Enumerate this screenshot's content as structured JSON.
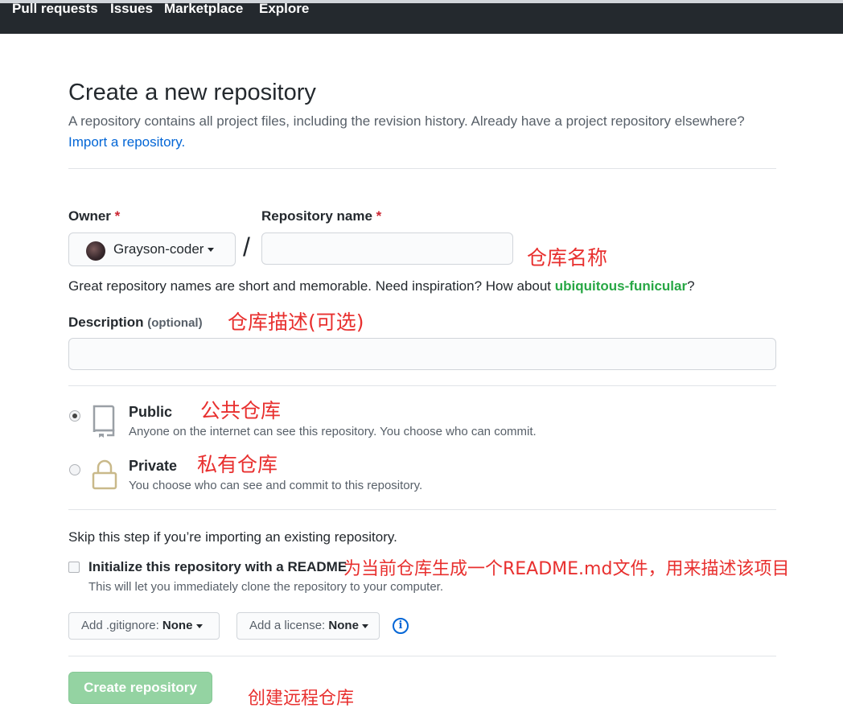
{
  "nav": {
    "items": [
      "Pull requests",
      "Issues",
      "Marketplace",
      "Explore"
    ]
  },
  "page": {
    "title": "Create a new repository",
    "subtitle": "A repository contains all project files, including the revision history. Already have a project repository elsewhere?",
    "import_link": "Import a repository."
  },
  "owner": {
    "label": "Owner",
    "required_mark": "*",
    "selected": "Grayson-coder",
    "slash": "/"
  },
  "repo_name": {
    "label": "Repository name",
    "required_mark": "*",
    "value": "",
    "hint_prefix": "Great repository names are short and memorable. Need inspiration? How about",
    "suggestion": "ubiquitous-funicular",
    "hint_suffix": "?"
  },
  "description": {
    "label": "Description",
    "optional": "(optional)",
    "value": ""
  },
  "visibility": {
    "public": {
      "title": "Public",
      "desc": "Anyone on the internet can see this repository. You choose who can commit.",
      "checked": true
    },
    "private": {
      "title": "Private",
      "desc": "You choose who can see and commit to this repository.",
      "checked": false
    }
  },
  "init": {
    "skip_text": "Skip this step if you’re importing an existing repository.",
    "readme_label": "Initialize this repository with a README",
    "readme_desc": "This will let you immediately clone the repository to your computer.",
    "gitignore_prefix": "Add .gitignore:",
    "gitignore_value": "None",
    "license_prefix": "Add a license:",
    "license_value": "None",
    "info_icon": "i"
  },
  "create_button": "Create repository",
  "annotations": {
    "repo_name": "仓库名称",
    "description": "仓库描述(可选)",
    "public": "公共仓库",
    "private": "私有仓库",
    "readme": "为当前仓库生成一个README.md文件，用来描述该项目",
    "create": "创建远程仓库"
  },
  "colors": {
    "header_bg": "#24292e",
    "link": "#0366d6",
    "required": "#cb2431",
    "suggestion": "#28a745",
    "create_button_bg": "#94d3a2",
    "annotation": "#e8302f"
  }
}
